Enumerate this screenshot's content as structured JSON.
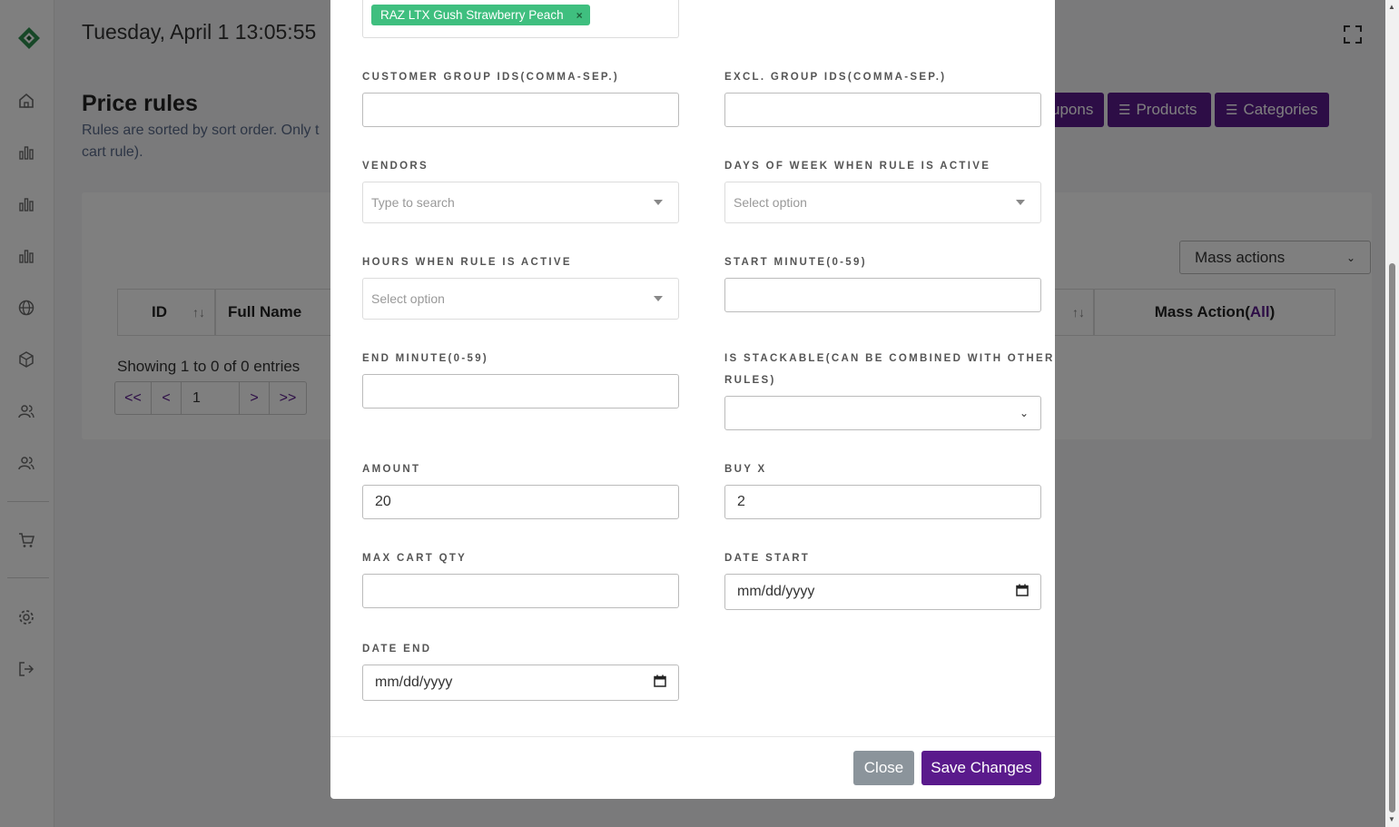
{
  "header": {
    "datetime": "Tuesday, April 1 13:05:55"
  },
  "page": {
    "title": "Price rules",
    "description": "Rules are sorted by sort order. Only t cart rule).",
    "tabs": [
      {
        "label": "upons"
      },
      {
        "label": "Products"
      },
      {
        "label": "Categories"
      }
    ],
    "mass_actions_label": "Mass actions",
    "table_headers": {
      "id": "ID",
      "full_name": "Full Name",
      "mass_action": "Mass Action(",
      "mass_action_all": "All",
      "mass_action_close": ")"
    },
    "showing": "Showing 1 to 0 of 0 entries",
    "pager": {
      "first": "<<",
      "prev": "<",
      "current": "1",
      "next": ">",
      "last": ">>"
    }
  },
  "sidebar": {
    "icons": [
      "home-icon",
      "chart-icon",
      "chart-icon",
      "chart-icon",
      "globe-icon",
      "box-icon",
      "users-icon",
      "users-icon",
      "cart-icon",
      "gear-icon",
      "logout-icon"
    ]
  },
  "modal": {
    "selected_tag": "RAZ LTX Gush Strawberry Peach",
    "fields": {
      "customer_group_ids": {
        "label": "CUSTOMER GROUP IDS(COMMA-SEP.)",
        "value": ""
      },
      "excl_group_ids": {
        "label": "EXCL. GROUP IDS(COMMA-SEP.)",
        "value": ""
      },
      "vendors": {
        "label": "VENDORS",
        "placeholder": "Type to search"
      },
      "days_of_week": {
        "label": "DAYS OF WEEK WHEN RULE IS ACTIVE",
        "placeholder": "Select option"
      },
      "hours": {
        "label": "HOURS WHEN RULE IS ACTIVE",
        "placeholder": "Select option"
      },
      "start_minute": {
        "label": "START MINUTE(0-59)",
        "value": ""
      },
      "end_minute": {
        "label": "END MINUTE(0-59)",
        "value": ""
      },
      "is_stackable": {
        "label_line1": "IS STACKABLE(CAN BE COMBINED WITH OTHER",
        "label_line2": "RULES)",
        "value": ""
      },
      "amount": {
        "label": "AMOUNT",
        "value": "20"
      },
      "buy_x": {
        "label": "BUY X",
        "value": "2"
      },
      "max_cart_qty": {
        "label": "MAX CART QTY",
        "value": ""
      },
      "date_start": {
        "label": "DATE START",
        "placeholder": "mm/dd/yyyy"
      },
      "date_end": {
        "label": "DATE END",
        "placeholder": "mm/dd/yyyy"
      }
    },
    "buttons": {
      "close": "Close",
      "save": "Save Changes"
    }
  },
  "colors": {
    "primary": "#5a1a8c",
    "tag": "#3fbf7f",
    "close_button": "#8b949b"
  }
}
